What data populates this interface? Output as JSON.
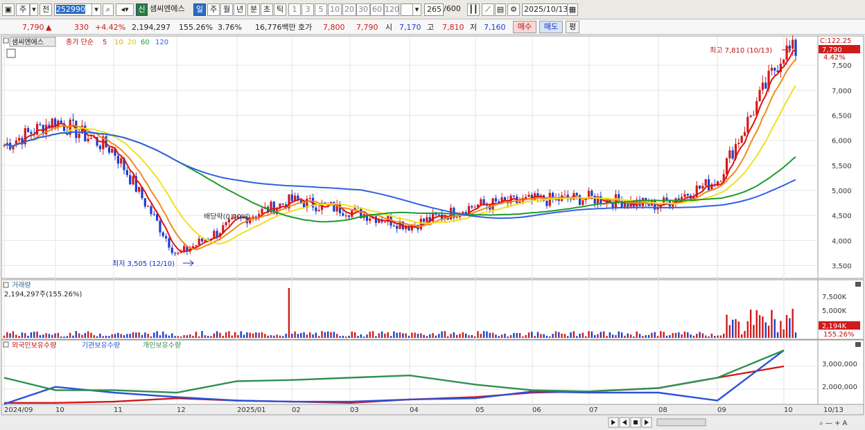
{
  "toolbar": {
    "tab_week": "주",
    "tab_prev": "전",
    "code": "252990",
    "badge_new": "신",
    "stock_name": "샘씨엔에스",
    "periods": [
      "일",
      "주",
      "월",
      "년",
      "분",
      "초",
      "틱"
    ],
    "active_period": "일",
    "intervals": [
      "1",
      "3",
      "5",
      "10",
      "20",
      "30",
      "60",
      "120"
    ],
    "count": "265",
    "count_total": "/600",
    "date": "2025/10/13"
  },
  "quote": {
    "price": "7,790",
    "arrow": "▲",
    "change": "330",
    "change_pct": "+4.42%",
    "volume": "2,194,297",
    "volume_ratio": "155.26%",
    "turnover": "3.76%",
    "amount": "16,776백만",
    "bid_label": "호가",
    "bid1": "7,800",
    "bid2": "7,790",
    "open_label": "시",
    "open": "7,170",
    "high_label": "고",
    "high": "7,810",
    "low_label": "저",
    "low": "7,160",
    "buy": "매수",
    "sell": "매도",
    "eval": "평"
  },
  "price_panel": {
    "name": "샘씨엔에스",
    "ma_title": "종가 단순",
    "ma_periods": [
      "5",
      "10",
      "20",
      "60",
      "120"
    ],
    "high_annot": "최고 7,810 (10/13)",
    "low_annot": "최저 3,505 (12/10)",
    "dividend_annot": "배당락(0.00%)",
    "c_label": "C:122.25",
    "last_tag": "7,790",
    "pct_tag": "4.42%",
    "y_ticks": [
      "7,500",
      "7,000",
      "6,500",
      "6,000",
      "5,500",
      "5,000",
      "4,500",
      "4,000",
      "3,500"
    ]
  },
  "volume_panel": {
    "title": "거래량",
    "value": "2,194,297주(155.26%)",
    "y_ticks": [
      "7,500K",
      "5,000K"
    ],
    "tag": "2,194K",
    "pct_tag": "155.26%"
  },
  "holding_panel": {
    "series": [
      "외국인보유수량",
      "기관보유수량",
      "개인보유수량"
    ],
    "y_ticks": [
      "3,000,000",
      "2,000,000"
    ]
  },
  "x_labels": [
    "2024/09",
    "10",
    "11",
    "12",
    "2025/01",
    "02",
    "03",
    "04",
    "05",
    "06",
    "07",
    "08",
    "09",
    "10"
  ],
  "x_right_label": "10/13",
  "colors": {
    "up": "#d11a1a",
    "down": "#1a3fd1",
    "ma5": "#e01010",
    "ma10": "#ef8a1a",
    "ma20": "#f0e020",
    "ma60": "#1f9a2a",
    "ma120": "#3060e0",
    "foreign": "#d41414",
    "inst": "#2a52d8",
    "indiv": "#2f8f50"
  },
  "chart_data": {
    "type": "line",
    "title": "샘씨엔에스",
    "ylim": [
      3300,
      8000
    ],
    "anchors": [
      {
        "x": "2024/09",
        "close": 5900
      },
      {
        "x": "10",
        "close": 6400
      },
      {
        "x": "11",
        "close": 5800
      },
      {
        "x": "12",
        "close": 3700
      },
      {
        "x": "2025/01",
        "close": 4400
      },
      {
        "x": "02",
        "close": 4800
      },
      {
        "x": "03",
        "close": 4600
      },
      {
        "x": "04",
        "close": 4300
      },
      {
        "x": "05",
        "close": 4700
      },
      {
        "x": "06",
        "close": 4800
      },
      {
        "x": "07",
        "close": 4850
      },
      {
        "x": "08",
        "close": 4700
      },
      {
        "x": "09",
        "close": 5200
      },
      {
        "x": "10",
        "close": 7790
      }
    ],
    "series": [
      {
        "name": "외국인보유수량",
        "values": [
          1.4,
          1.4,
          1.45,
          1.6,
          1.5,
          1.45,
          1.4,
          1.55,
          1.65,
          1.85,
          1.9,
          2.05,
          2.5,
          3.0
        ]
      },
      {
        "name": "기관보유수량",
        "values": [
          1.35,
          2.1,
          1.85,
          1.65,
          1.5,
          1.45,
          1.45,
          1.55,
          1.6,
          1.9,
          1.85,
          1.85,
          1.5,
          3.7
        ]
      },
      {
        "name": "개인보유수량",
        "values": [
          2.5,
          1.95,
          1.95,
          1.85,
          2.35,
          2.4,
          2.5,
          2.6,
          2.2,
          1.95,
          1.9,
          2.05,
          2.5,
          3.7
        ]
      }
    ]
  }
}
